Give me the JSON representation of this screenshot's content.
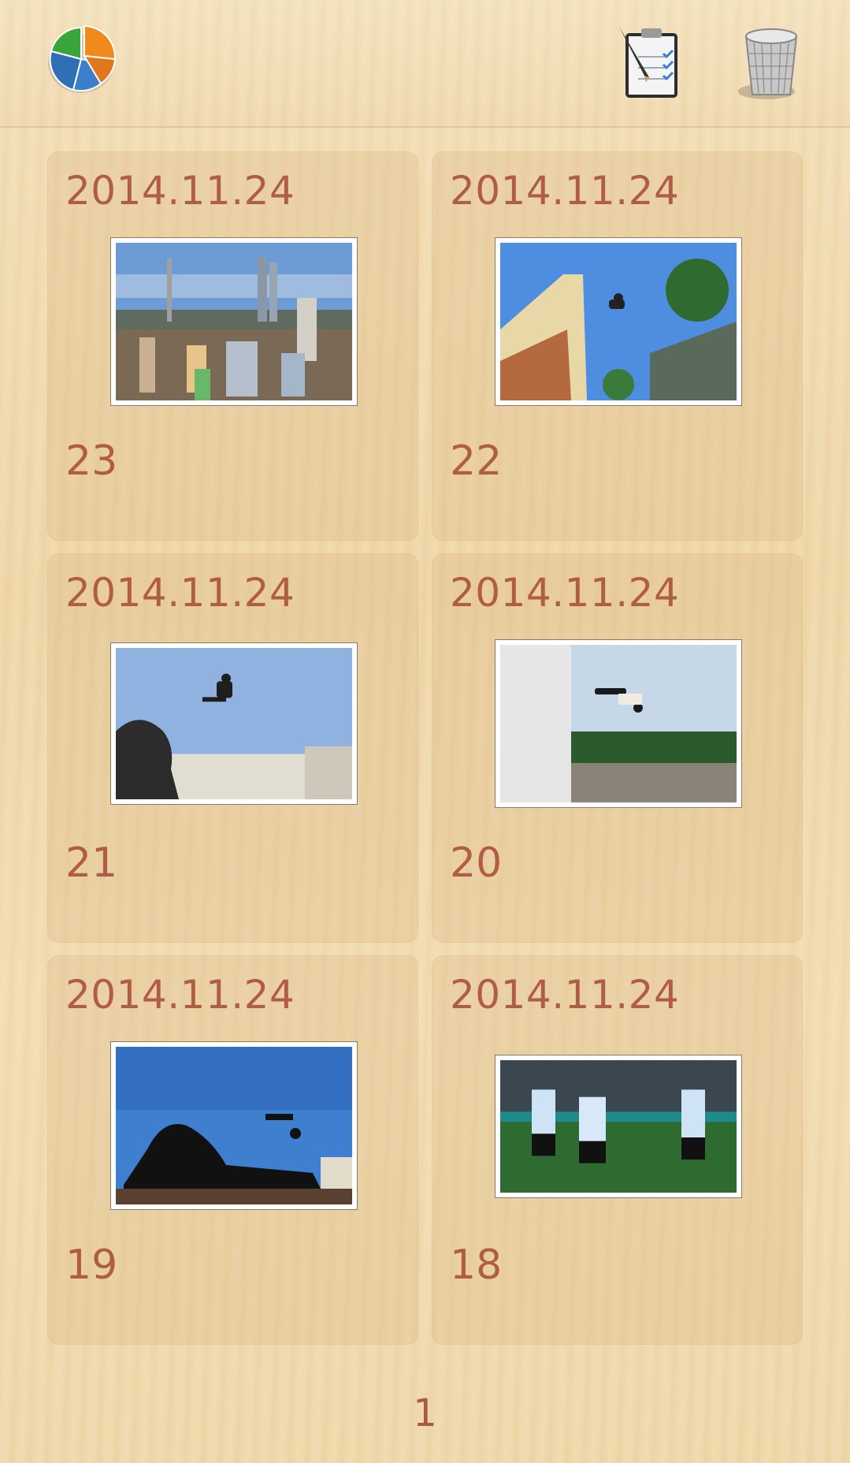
{
  "toolbar": {
    "left_icon": "pie-chart-icon",
    "right_icons": [
      "clipboard-checklist-icon",
      "trash-icon"
    ]
  },
  "cards": [
    {
      "date": "2014.11.24",
      "count": "23",
      "thumbnail": "city-skyline-photo"
    },
    {
      "date": "2014.11.24",
      "count": "22",
      "thumbnail": "rooftop-flip-photo"
    },
    {
      "date": "2014.11.24",
      "count": "21",
      "thumbnail": "lion-statue-jump-photo"
    },
    {
      "date": "2014.11.24",
      "count": "20",
      "thumbnail": "wall-flip-photo"
    },
    {
      "date": "2014.11.24",
      "count": "19",
      "thumbnail": "lion-silhouette-jump-photo"
    },
    {
      "date": "2014.11.24",
      "count": "18",
      "thumbnail": "football-players-photo"
    }
  ],
  "pagination": {
    "page": "1"
  },
  "colors": {
    "text_accent": "#b05d45",
    "background": "#f0d9ad"
  }
}
